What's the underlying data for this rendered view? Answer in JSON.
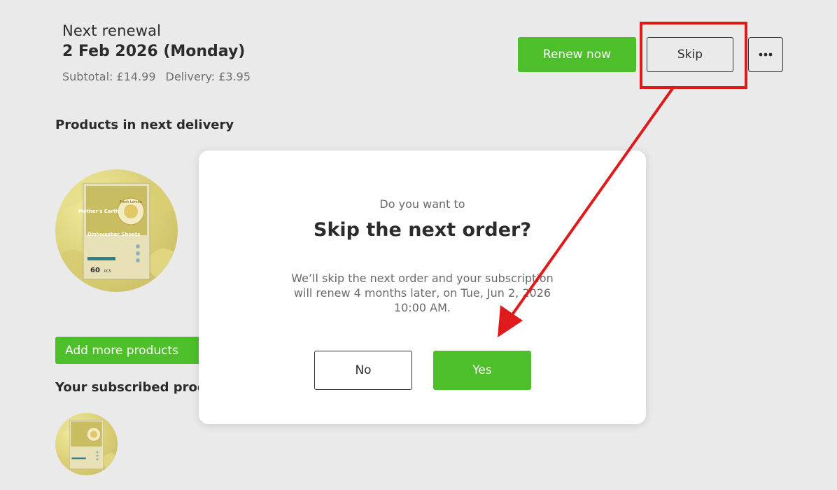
{
  "renewal": {
    "label": "Next renewal",
    "date": "2 Feb 2026 (Monday)",
    "subtotal": "Subtotal: £14.99",
    "delivery": "Delivery: £3.95"
  },
  "actions": {
    "renew_label": "Renew now",
    "skip_label": "Skip",
    "more_icon": "ellipsis-icon"
  },
  "sections": {
    "next_delivery_heading": "Products in next delivery",
    "add_more_label": "Add more products",
    "subscribed_heading": "Your subscribed products"
  },
  "product": {
    "brand": "Mother's Earth",
    "name": "Dishwasher Sheets",
    "badge": "Fresh Lemon",
    "count": "60",
    "count_unit": "PCS",
    "washes": "30 WASHES"
  },
  "modal": {
    "subtitle": "Do you want to",
    "title": "Skip the next order?",
    "body": "We’ll skip the next order and your subscription\nwill renew 4  months later, on Tue, Jun 2, 2026\n10:00 AM.",
    "no_label": "No",
    "yes_label": "Yes"
  },
  "colors": {
    "accent_green": "#4cbf2a",
    "annotation_red": "#e0191b",
    "background": "#eaeaea"
  }
}
